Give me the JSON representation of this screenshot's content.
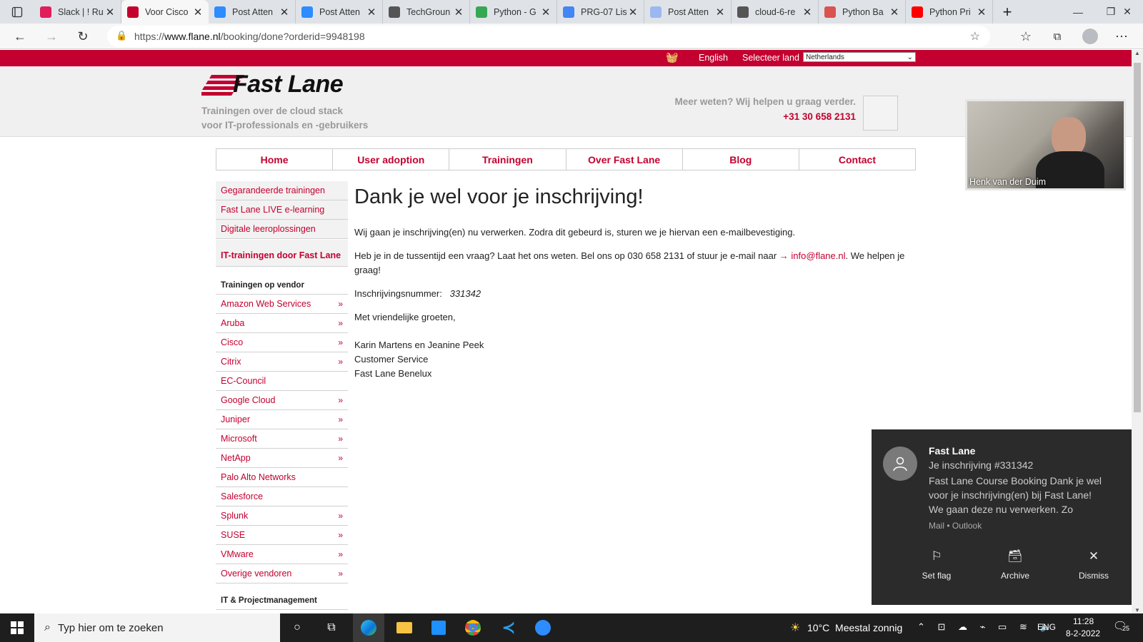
{
  "browser": {
    "tabs": [
      {
        "title": "Slack | ! Ru",
        "color": "#e01e5a",
        "active": false
      },
      {
        "title": "Voor Cisco",
        "color": "#c3002f",
        "active": true
      },
      {
        "title": "Post Atten",
        "color": "#2d8cff",
        "active": false
      },
      {
        "title": "Post Atten",
        "color": "#2d8cff",
        "active": false
      },
      {
        "title": "TechGroun",
        "color": "#555555",
        "active": false
      },
      {
        "title": "Python - G",
        "color": "#34a853",
        "active": false
      },
      {
        "title": "PRG-07 Lis",
        "color": "#4285f4",
        "active": false
      },
      {
        "title": "Post Atten",
        "color": "#9bb8f0",
        "active": false
      },
      {
        "title": "cloud-6-re",
        "color": "#555555",
        "active": false
      },
      {
        "title": "Python Ba",
        "color": "#d9534f",
        "active": false
      },
      {
        "title": "Python Pri",
        "color": "#ff0000",
        "active": false
      }
    ],
    "url_prefix": "https://",
    "url_domain": "www.flane.nl",
    "url_path": "/booking/done?orderid=9948198"
  },
  "site": {
    "accent": "#c3002f",
    "topbar": {
      "language": "English",
      "country_label": "Selecteer land",
      "country_value": "Netherlands"
    },
    "logo_text": "Fast Lane",
    "tagline_1": "Trainingen over de cloud stack",
    "tagline_2": "voor IT-professionals en -gebruikers",
    "help_text": "Meer weten? Wij helpen u graag verder.",
    "phone": "+31 30 658 2131",
    "menu": [
      "Home",
      "User adoption",
      "Trainingen",
      "Over Fast Lane",
      "Blog",
      "Contact"
    ],
    "sidebar": {
      "top_links": [
        "Gegarandeerde trainingen",
        "Fast Lane LIVE e-learning",
        "Digitale leeroplossingen"
      ],
      "featured": "IT-trainingen door Fast Lane",
      "vendor_heading": "Trainingen op vendor",
      "vendors": [
        {
          "label": "Amazon Web Services",
          "arrow": "»"
        },
        {
          "label": "Aruba",
          "arrow": "»"
        },
        {
          "label": "Cisco",
          "arrow": "»"
        },
        {
          "label": "Citrix",
          "arrow": "»"
        },
        {
          "label": "EC-Council",
          "arrow": ""
        },
        {
          "label": "Google Cloud",
          "arrow": "»"
        },
        {
          "label": "Juniper",
          "arrow": "»"
        },
        {
          "label": "Microsoft",
          "arrow": "»"
        },
        {
          "label": "NetApp",
          "arrow": "»"
        },
        {
          "label": "Palo Alto Networks",
          "arrow": ""
        },
        {
          "label": "Salesforce",
          "arrow": ""
        },
        {
          "label": "Splunk",
          "arrow": "»"
        },
        {
          "label": "SUSE",
          "arrow": "»"
        },
        {
          "label": "VMware",
          "arrow": "»"
        },
        {
          "label": "Overige vendoren",
          "arrow": "»"
        }
      ],
      "bottom_heading": "IT & Projectmanagement"
    },
    "content": {
      "title": "Dank je wel voor je inschrijving!",
      "p1": "Wij gaan je inschrijving(en) nu verwerken. Zodra dit gebeurd is, sturen we je hiervan een e-mailbevestiging.",
      "p2_before": "Heb je in de tussentijd een vraag? Laat het ons weten. Bel ons op 030 658 2131 of stuur je e-mail naar ",
      "p2_arrow": "→",
      "p2_email": "info@flane.nl",
      "p2_after": ". We helpen je graag!",
      "reg_label": "Inschrijvingsnummer:",
      "reg_number": "331342",
      "greeting": "Met vriendelijke groeten,",
      "sign_1": "Karin Martens en Jeanine Peek",
      "sign_2": "Customer Service",
      "sign_3": "Fast Lane Benelux"
    }
  },
  "webcam": {
    "name": "Henk van der Duim"
  },
  "notification": {
    "app": "Fast Lane",
    "subject": "Je inschrijving #331342",
    "body": "Fast Lane Course Booking Dank je wel voor je inschrijving(en) bij Fast Lane! We gaan deze nu verwerken. Zo",
    "source": "Mail • Outlook",
    "actions": [
      "Set flag",
      "Archive",
      "Dismiss"
    ]
  },
  "taskbar": {
    "search_placeholder": "Typ hier om te zoeken",
    "weather": "10°C  Meestal zonnig",
    "lang": "ENG",
    "time": "11:28",
    "date": "8-2-2022",
    "notif_count": "25"
  }
}
